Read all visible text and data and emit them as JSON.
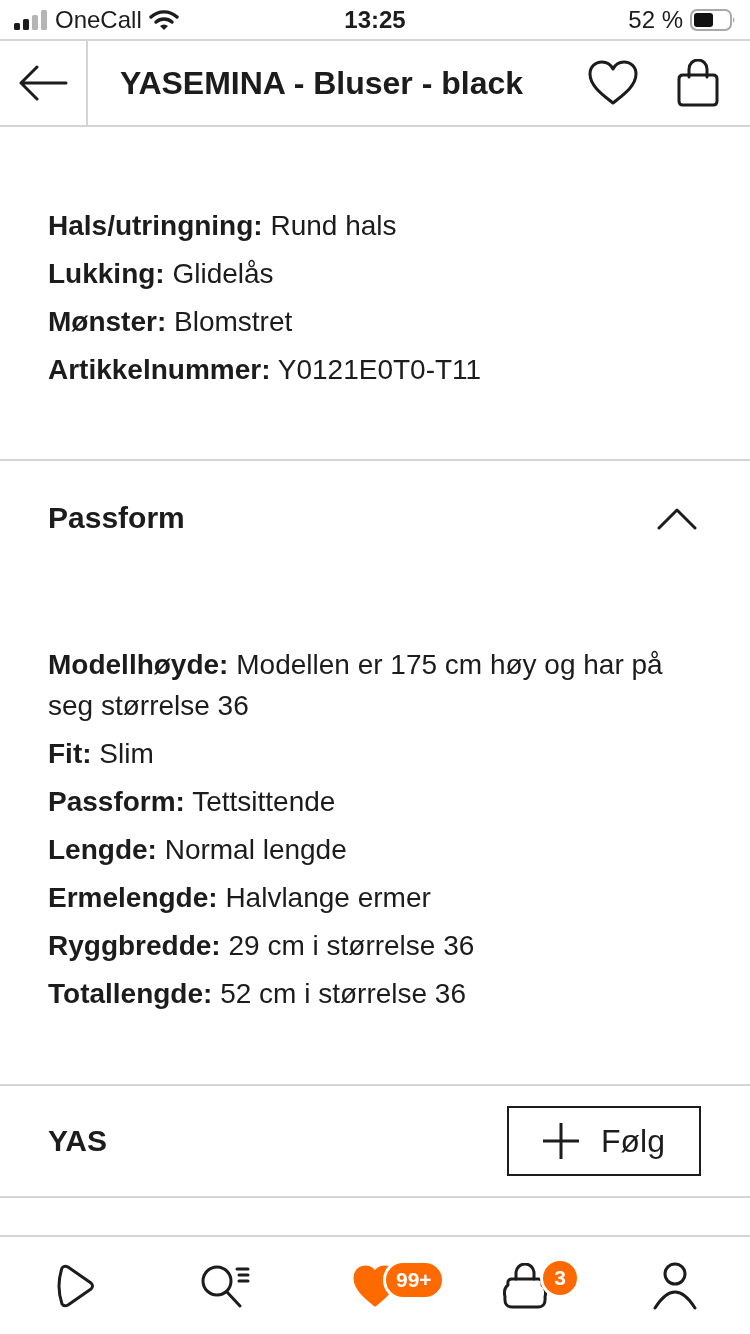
{
  "status_bar": {
    "carrier": "OneCall",
    "time": "13:25",
    "battery": "52 %"
  },
  "header": {
    "title": "YASEMINA - Bluser - black"
  },
  "details": {
    "lines": [
      "**Hals/utringning:** Rund hals",
      "**Lukking:** Glidelås",
      "**Mønster:** Blomstret",
      "**Artikkelnummer:** Y0121E0T0-T11"
    ]
  },
  "fit_section": {
    "title": "Passform",
    "expanded": true,
    "lines": [
      "**Modellhøyde:** Modellen er 175 cm høy og har på seg størrelse 36",
      "**Fit:** Slim",
      "**Passform:** Tettsittende",
      "**Lengde:** Normal lengde",
      "**Ermelengde:** Halvlange ermer",
      "**Ryggbredde:** 29 cm i størrelse 36",
      "**Totallengde:** 52 cm i størrelse 36"
    ]
  },
  "brand": {
    "name": "YAS",
    "follow_button": "Følg"
  },
  "tab_bar": {
    "tabs": [
      {
        "kind": "home",
        "selected": false
      },
      {
        "kind": "search",
        "selected": false
      },
      {
        "kind": "wishlist",
        "selected": true,
        "badge": "99+"
      },
      {
        "kind": "cart",
        "selected": false,
        "badge": "3"
      },
      {
        "kind": "profile",
        "selected": false
      }
    ]
  }
}
